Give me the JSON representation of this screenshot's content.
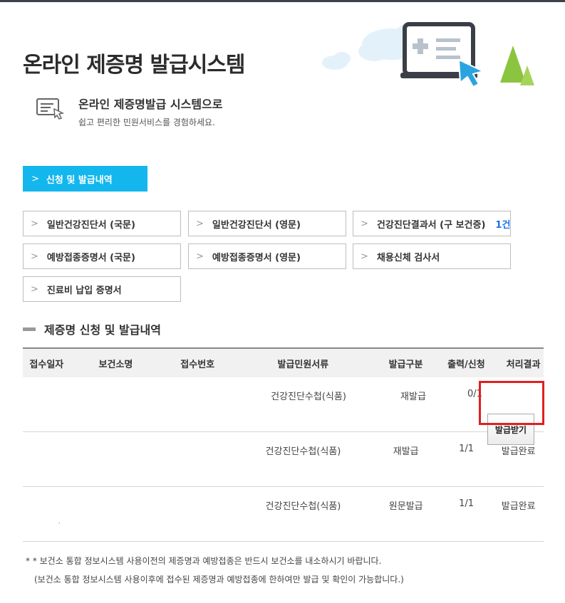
{
  "page": {
    "title": "온라인 제증명 발급시스템"
  },
  "intro": {
    "heading": "온라인 제증명발급 시스템으로",
    "subtext": "쉽고 편리한 민원서비스를 경험하세요."
  },
  "history_button": {
    "label": "신청 및 발급내역"
  },
  "certificates": [
    {
      "label": "일반건강진단서 (국문)"
    },
    {
      "label": "일반건강진단서 (영문)"
    },
    {
      "label": "건강진단결과서 (구 보건증)",
      "count": "1건"
    },
    {
      "label": "예방접종증명서 (국문)"
    },
    {
      "label": "예방접종증명서 (영문)"
    },
    {
      "label": "채용신체 검사서"
    },
    {
      "label": "진료비 납입 증명서"
    }
  ],
  "section": {
    "title": "제증명 신청 및 발급내역"
  },
  "table": {
    "headers": [
      "접수일자",
      "보건소명",
      "접수번호",
      "발급민원서류",
      "발급구분",
      "출력/신청",
      "처리결과"
    ],
    "rows": [
      {
        "date": "",
        "center": "",
        "number": "",
        "document": "건강진단수첩(식품)",
        "type": "재발급",
        "print": "0/1",
        "result": "발급받기"
      },
      {
        "date": "",
        "center": "",
        "number": "",
        "document": "건강진단수첩(식품)",
        "type": "재발급",
        "print": "1/1",
        "result": "발급완료"
      },
      {
        "date": "",
        "center": "",
        "number": "",
        "document": "건강진단수첩(식품)",
        "type": "원문발급",
        "print": "1/1",
        "result": "발급완료",
        "mark": "."
      }
    ]
  },
  "notes": [
    "* * 보건소 통합 정보시스템 사용이전의 제증명과 예방접종은 반드시 보건소를 내소하시기 바랍니다.",
    "(보건소 통합 정보시스템 사용이후에 접수된 제증명과 예방접종에 한하여만 발급 및 확인이 가능합니다.)"
  ],
  "colors": {
    "accent": "#13b7ee",
    "highlight": "#e02020",
    "count": "#1a73e8"
  },
  "icons": {
    "chevron": "chevron-right-icon",
    "intro": "certificate-pointer-icon"
  }
}
